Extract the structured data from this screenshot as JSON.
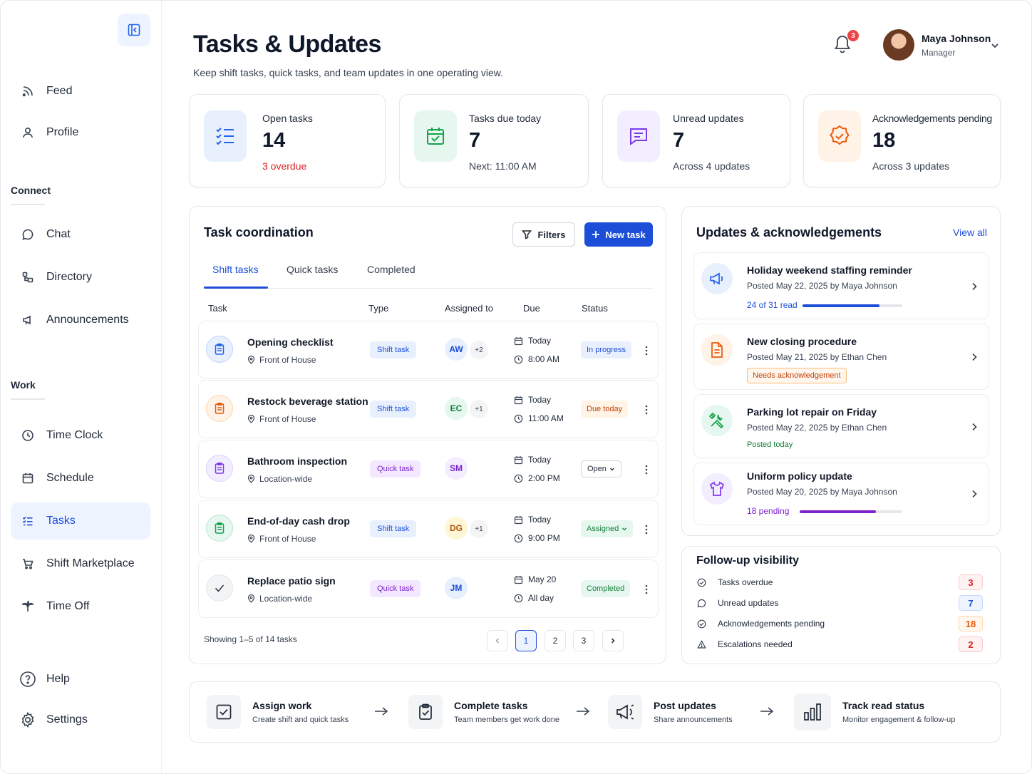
{
  "sidebar": {
    "items_top": [
      {
        "label": "Feed",
        "icon": "rss-icon"
      },
      {
        "label": "Profile",
        "icon": "user-icon"
      }
    ],
    "connect_title": "Connect",
    "items_connect": [
      {
        "label": "Chat",
        "icon": "chat-icon"
      },
      {
        "label": "Directory",
        "icon": "directory-icon"
      },
      {
        "label": "Announcements",
        "icon": "megaphone-icon"
      }
    ],
    "work_title": "Work",
    "items_work": [
      {
        "label": "Time Clock",
        "icon": "clock-icon"
      },
      {
        "label": "Schedule",
        "icon": "calendar-icon"
      },
      {
        "label": "Tasks",
        "icon": "tasks-icon",
        "active": true
      },
      {
        "label": "Shift Marketplace",
        "icon": "cart-icon"
      },
      {
        "label": "Time Off",
        "icon": "palm-tree-icon"
      }
    ],
    "items_bottom": [
      {
        "label": "Help",
        "icon": "help-icon"
      },
      {
        "label": "Settings",
        "icon": "gear-icon"
      }
    ]
  },
  "header": {
    "title": "Tasks & Updates",
    "subtitle": "Keep shift tasks, quick tasks, and team updates in one operating view.",
    "notification_count": "3",
    "user_name": "Maya Johnson",
    "user_role": "Manager"
  },
  "stats": [
    {
      "label": "Open tasks",
      "value": "14",
      "note": "3 overdue",
      "note_color": "#dc2626",
      "accent": "#2563eb"
    },
    {
      "label": "Tasks due today",
      "value": "7",
      "note": "Next: 11:00 AM",
      "accent": "#16a34a"
    },
    {
      "label": "Unread updates",
      "value": "7",
      "note": "Across 4 updates",
      "accent": "#7c3aed"
    },
    {
      "label": "Acknowledgements pending",
      "value": "18",
      "note": "Across 3 updates",
      "accent": "#ea580c"
    }
  ],
  "tasks_panel": {
    "title": "Task coordination",
    "filters_label": "Filters",
    "new_task_label": "New task",
    "tabs": [
      "Shift tasks",
      "Quick tasks",
      "Completed"
    ],
    "columns": [
      "Task",
      "Type",
      "Assigned to",
      "Due",
      "Status"
    ],
    "rows": [
      {
        "name": "Opening checklist",
        "location": "Front of House",
        "type": "Shift task",
        "assignee": "AW",
        "extra": "+2",
        "due_day": "Today",
        "due_time": "8:00 AM",
        "status": "In progress"
      },
      {
        "name": "Restock beverage station",
        "location": "Front of House",
        "type": "Shift task",
        "assignee": "EC",
        "extra": "+1",
        "due_day": "Today",
        "due_time": "11:00 AM",
        "status": "Due today"
      },
      {
        "name": "Bathroom inspection",
        "location": "Location-wide",
        "type": "Quick task",
        "assignee": "SM",
        "extra": "",
        "due_day": "Today",
        "due_time": "2:00 PM",
        "status": "Open"
      },
      {
        "name": "End-of-day cash drop",
        "location": "Front of House",
        "type": "Shift task",
        "assignee": "DG",
        "extra": "+1",
        "due_day": "Today",
        "due_time": "9:00 PM",
        "status": "Assigned"
      },
      {
        "name": "Replace patio sign",
        "location": "Location-wide",
        "type": "Quick task",
        "assignee": "JM",
        "extra": "",
        "due_day": "May 20",
        "due_time": "All day",
        "status": "Completed"
      }
    ],
    "showing": "Showing 1–5 of 14 tasks",
    "pages": [
      "1",
      "2",
      "3"
    ],
    "current_page": "1"
  },
  "updates_panel": {
    "title": "Updates & acknowledgements",
    "view_all": "View all",
    "items": [
      {
        "title": "Holiday weekend staffing reminder",
        "meta": "Posted May 22, 2025 by Maya Johnson",
        "progress_text": "24 of 31 read",
        "progress": 0.77,
        "icon": "megaphone-icon"
      },
      {
        "title": "New closing procedure",
        "meta": "Posted May 21, 2025 by Ethan Chen",
        "badge": "Needs acknowledgement",
        "icon": "document-icon"
      },
      {
        "title": "Parking lot repair on Friday",
        "meta": "Posted May 22, 2025 by Ethan Chen",
        "note": "Posted today",
        "icon": "tools-icon"
      },
      {
        "title": "Uniform policy update",
        "meta": "Posted May 20, 2025 by Maya Johnson",
        "progress_text": "18 pending",
        "progress": 0.74,
        "icon": "shirt-icon"
      }
    ]
  },
  "followup": {
    "title": "Follow-up visibility",
    "items": [
      {
        "label": "Tasks overdue",
        "value": "3"
      },
      {
        "label": "Unread updates",
        "value": "7"
      },
      {
        "label": "Acknowledgements pending",
        "value": "18"
      },
      {
        "label": "Escalations needed",
        "value": "2"
      }
    ]
  },
  "workflow": [
    {
      "title": "Assign work",
      "subtitle": "Create shift and quick tasks"
    },
    {
      "title": "Complete tasks",
      "subtitle": "Team members get work done"
    },
    {
      "title": "Post updates",
      "subtitle": "Share announcements"
    },
    {
      "title": "Track read status",
      "subtitle": "Monitor engagement & follow-up"
    }
  ]
}
